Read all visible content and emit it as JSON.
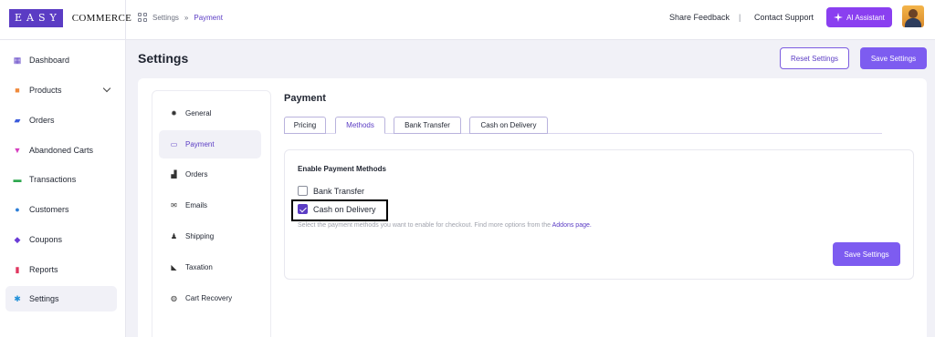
{
  "brand": {
    "easy": "EASY",
    "commerce": "COMMERCE"
  },
  "breadcrumb": {
    "root": "Settings",
    "separator": "»",
    "current": "Payment"
  },
  "header": {
    "share_feedback": "Share Feedback",
    "separator": "|",
    "contact_support": "Contact Support",
    "ai_assistant": "AI Assistant"
  },
  "sidebar": {
    "items": [
      {
        "label": "Dashboard",
        "icon": "dashboard-icon",
        "color": "#5b3cc4"
      },
      {
        "label": "Products",
        "icon": "products-icon",
        "color": "#f08a3c"
      },
      {
        "label": "Orders",
        "icon": "orders-icon",
        "color": "#3b5bdb"
      },
      {
        "label": "Abandoned Carts",
        "icon": "cart-icon",
        "color": "#d63fc0"
      },
      {
        "label": "Transactions",
        "icon": "money-icon",
        "color": "#2fa84f"
      },
      {
        "label": "Customers",
        "icon": "customers-icon",
        "color": "#2d7fd8"
      },
      {
        "label": "Coupons",
        "icon": "coupon-icon",
        "color": "#6a3cd6"
      },
      {
        "label": "Reports",
        "icon": "report-icon",
        "color": "#e0365f"
      },
      {
        "label": "Settings",
        "icon": "gear-icon",
        "color": "#1f8fd8"
      }
    ]
  },
  "page": {
    "title": "Settings",
    "reset_label": "Reset Settings",
    "save_label": "Save Settings"
  },
  "settings_nav": {
    "items": [
      {
        "label": "General",
        "icon": "gear-icon"
      },
      {
        "label": "Payment",
        "icon": "card-icon"
      },
      {
        "label": "Orders",
        "icon": "bag-icon"
      },
      {
        "label": "Emails",
        "icon": "mail-icon"
      },
      {
        "label": "Shipping",
        "icon": "person-icon"
      },
      {
        "label": "Taxation",
        "icon": "tag-icon"
      },
      {
        "label": "Cart Recovery",
        "icon": "recovery-icon"
      }
    ],
    "active": "Payment"
  },
  "payment": {
    "title": "Payment",
    "tabs": [
      "Pricing",
      "Methods",
      "Bank Transfer",
      "Cash on Delivery"
    ],
    "active_tab": "Methods",
    "panel_heading": "Enable Payment Methods",
    "methods": [
      {
        "label": "Bank Transfer",
        "checked": false
      },
      {
        "label": "Cash on Delivery",
        "checked": true
      }
    ],
    "help_text": "Select the payment methods you want to enable for checkout. Find more options from the",
    "help_link": "Addons page.",
    "save_label": "Save Settings"
  },
  "colors": {
    "accent": "#5b3cc4",
    "button": "#7d5cf0",
    "ai_button": "#8a3ff0"
  }
}
